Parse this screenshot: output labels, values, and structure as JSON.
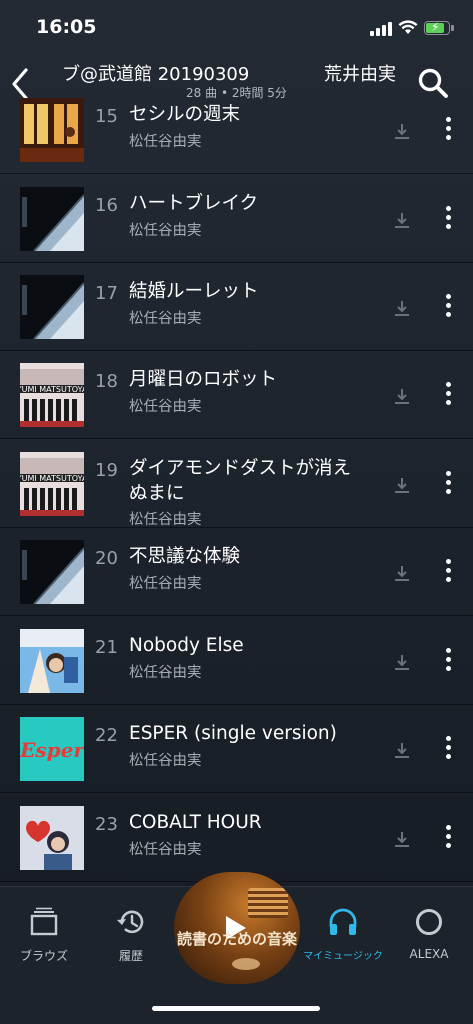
{
  "status_bar": {
    "time": "16:05"
  },
  "header": {
    "title": "ブ@武道館 20190309",
    "artist": "荒井由実",
    "subtitle": "28 曲 • 2時間 5分"
  },
  "tracks": [
    {
      "number": "15",
      "title": "セシルの週末",
      "artist": "松任谷由実",
      "art": "cecil"
    },
    {
      "number": "16",
      "title": "ハートブレイク",
      "artist": "松任谷由実",
      "art": "building"
    },
    {
      "number": "17",
      "title": "結婚ルーレット",
      "artist": "松任谷由実",
      "art": "building"
    },
    {
      "number": "18",
      "title": "月曜日のロボット",
      "artist": "松任谷由実",
      "art": "robot"
    },
    {
      "number": "19",
      "title": "ダイアモンドダストが消えぬまに",
      "artist": "松任谷由実",
      "art": "robot"
    },
    {
      "number": "20",
      "title": "不思議な体験",
      "artist": "松任谷由実",
      "art": "building"
    },
    {
      "number": "21",
      "title": "Nobody Else",
      "artist": "松任谷由実",
      "art": "nobody"
    },
    {
      "number": "22",
      "title": "ESPER (single version)",
      "artist": "松任谷由実",
      "art": "esper"
    },
    {
      "number": "23",
      "title": "COBALT HOUR",
      "artist": "松任谷由実",
      "art": "cobalt"
    }
  ],
  "player": {
    "title": "読書のための音楽"
  },
  "nav": {
    "browse": "ブラウズ",
    "history": "履歴",
    "my_music": "マイミュージック",
    "alexa": "ALEXA"
  },
  "colors": {
    "accent": "#2fb8e8",
    "background": "#1c232c",
    "battery": "#5ed05a"
  }
}
